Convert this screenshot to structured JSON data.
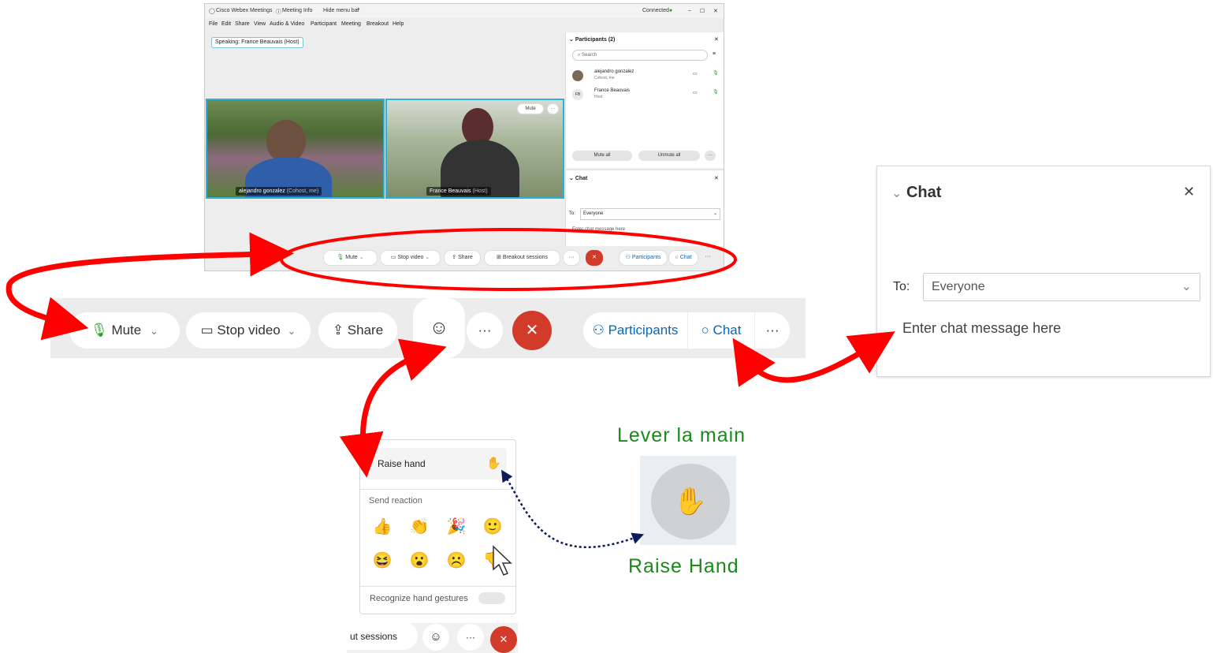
{
  "window": {
    "app_title": "Cisco Webex Meetings",
    "meeting_info": "Meeting Info",
    "hide_menu_bar": "Hide menu bar",
    "connected": "Connected",
    "menu": [
      "File",
      "Edit",
      "Share",
      "View",
      "Audio & Video",
      "Participant",
      "Meeting",
      "Breakout",
      "Help"
    ],
    "speaking": "Speaking: France Beauvais (Host)"
  },
  "videos": [
    {
      "name": "alejandro gonzalez",
      "role": "(Cohost, me)"
    },
    {
      "name": "France Beauvais",
      "role": "(Host)",
      "mute_label": "Mute"
    }
  ],
  "participants_panel": {
    "title": "Participants (2)",
    "search_placeholder": "Search",
    "people": [
      {
        "name": "alejandro gonzalez",
        "role": "Cohost, me"
      },
      {
        "name": "France Beauvais",
        "role": "Host",
        "initials": "FB"
      }
    ],
    "mute_all": "Mute all",
    "unmute_all": "Unmute all"
  },
  "chat_panel_small": {
    "title": "Chat",
    "to_label": "To:",
    "to_value": "Everyone",
    "placeholder": "Enter chat message here"
  },
  "window_toolbar": {
    "mute": "Mute",
    "stop_video": "Stop video",
    "share": "Share",
    "breakout": "Breakout sessions",
    "participants": "Participants",
    "chat": "Chat"
  },
  "big_toolbar": {
    "mute": "Mute",
    "stop_video": "Stop video",
    "share": "Share",
    "participants": "Participants",
    "chat": "Chat"
  },
  "big_chat": {
    "title": "Chat",
    "to_label": "To:",
    "to_value": "Everyone",
    "placeholder": "Enter chat message here"
  },
  "reaction_popup": {
    "raise_hand": "Raise hand",
    "send_reaction": "Send reaction",
    "emojis": [
      "👍",
      "👏",
      "🎉",
      "🙂",
      "😆",
      "😮",
      "☹️",
      "👎"
    ],
    "gestures": "Recognize hand gestures",
    "bottom_sessions": "ut sessions"
  },
  "annotation": {
    "french": "Lever la main",
    "english": "Raise Hand"
  },
  "colors": {
    "accent_blue": "#0a66b7",
    "end_red": "#d23a2a",
    "arrow_red": "#ff0000",
    "label_green": "#1a8a1a"
  }
}
